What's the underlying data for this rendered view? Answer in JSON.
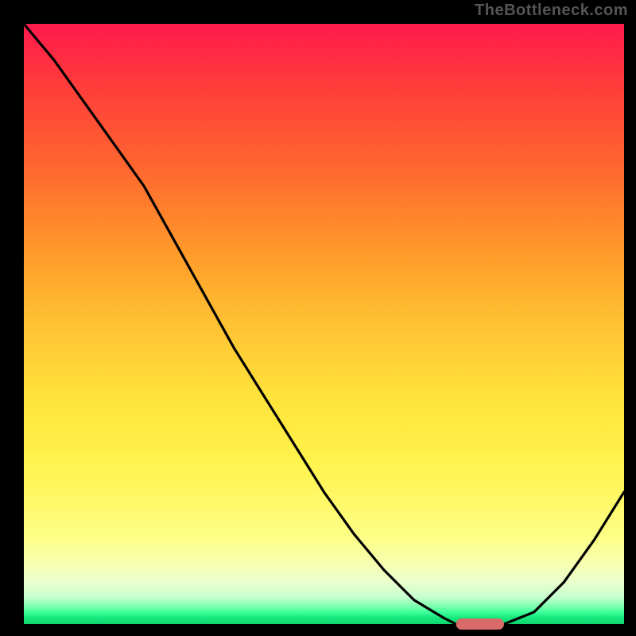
{
  "watermark": "TheBottleneck.com",
  "colors": {
    "grad_top": "#ff1a4d",
    "grad_mid": "#ffe23a",
    "grad_bot": "#0fd56e",
    "curve": "#000000",
    "marker": "#d96a6a",
    "background": "#000000"
  },
  "chart_data": {
    "type": "line",
    "title": "",
    "xlabel": "",
    "ylabel": "",
    "xlim": [
      0,
      100
    ],
    "ylim": [
      0,
      100
    ],
    "grid": false,
    "legend": false,
    "x": [
      0,
      5,
      10,
      15,
      20,
      25,
      30,
      35,
      40,
      45,
      50,
      55,
      60,
      65,
      70,
      72,
      75,
      80,
      85,
      90,
      95,
      100
    ],
    "values": [
      100,
      94,
      87,
      80,
      73,
      64,
      55,
      46,
      38,
      30,
      22,
      15,
      9,
      4,
      1,
      0,
      0,
      0,
      2,
      7,
      14,
      22
    ],
    "optimum_marker": {
      "x_start": 72,
      "x_end": 80,
      "y": 0
    },
    "annotations": []
  }
}
